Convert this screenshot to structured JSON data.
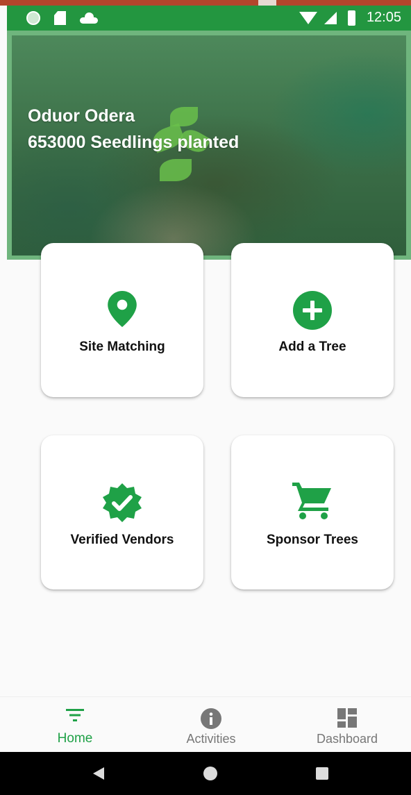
{
  "status_bar": {
    "time": "12:05",
    "icons": [
      "notification-dot-icon",
      "sd-card-icon",
      "cloud-icon",
      "wifi-icon",
      "signal-icon",
      "battery-icon"
    ]
  },
  "hero": {
    "user_name": "Oduor Odera",
    "seedlings_text": "653000 Seedlings planted"
  },
  "cards": [
    {
      "label": "Site Matching",
      "icon": "location-pin-icon"
    },
    {
      "label": "Add a Tree",
      "icon": "add-circle-icon"
    },
    {
      "label": "Verified Vendors",
      "icon": "verified-badge-icon"
    },
    {
      "label": "Sponsor Trees",
      "icon": "shopping-cart-icon"
    }
  ],
  "bottom_nav": {
    "items": [
      {
        "label": "Home",
        "icon": "filter-list-icon",
        "active": true
      },
      {
        "label": "Activities",
        "icon": "info-icon",
        "active": false
      },
      {
        "label": "Dashboard",
        "icon": "dashboard-icon",
        "active": false
      }
    ]
  },
  "colors": {
    "accent_green": "#1fa147",
    "status_bar_green": "#239640",
    "icon_gray": "#777777"
  }
}
